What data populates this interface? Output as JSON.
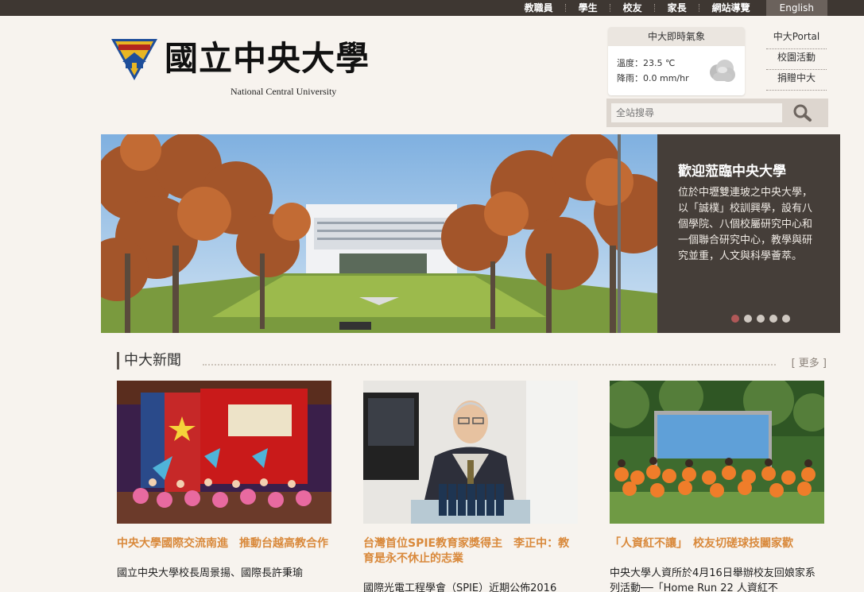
{
  "top_nav": {
    "items": [
      "教職員",
      "學生",
      "校友",
      "家長",
      "網站導覽"
    ],
    "lang": "English"
  },
  "logo": {
    "name_cn": "國立中央大學",
    "name_en": "National Central University",
    "emblem_text": "國立中央大學"
  },
  "weather": {
    "title": "中大即時氣象",
    "temp_label": "溫度：",
    "temp_value": "23.5 ℃",
    "rain_label": "降雨：",
    "rain_value": "0.0 mm/hr"
  },
  "quick_links": [
    "中大Portal",
    "校園活動",
    "捐贈中大"
  ],
  "search": {
    "placeholder": "全站搜尋"
  },
  "banner": {
    "title": "歡迎蒞臨中央大學",
    "text": "位於中壢雙連坡之中央大學，以「誠樸」校訓興學，設有八個學院、八個校屬研究中心和一個聯合研究中心，教學與研究並重，人文與科學薈萃。",
    "slides": 5,
    "active_slide": 1
  },
  "news": {
    "title": "中大新聞",
    "more": "[ 更多 ]",
    "items": [
      {
        "title": "中央大學國際交流南進　推動台越高教合作",
        "text": "國立中央大學校長周景揚、國際長許秉瑜"
      },
      {
        "title": "台灣首位SPIE教育家獎得主　李正中：教育是永不休止的志業",
        "text": "國際光電工程學會（SPIE）近期公佈2016"
      },
      {
        "title": "「人資紅不讓」　校友切磋球技闔家歡",
        "text": "中央大學人資所於4月16日舉辦校友回娘家系列活動──「Home Run 22 人資紅不"
      }
    ]
  },
  "colors": {
    "topbar": "#3e3732",
    "accent_title": "#d9893b",
    "banner_panel": "#453e39",
    "dot_active": "#b05858"
  }
}
